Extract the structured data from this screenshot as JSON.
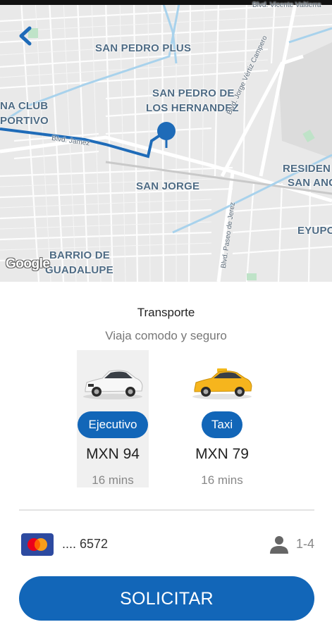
{
  "map": {
    "neighborhoods": [
      "SAN PEDRO PLUS",
      "NA CLUB",
      "PORTIVO",
      "SAN PEDRO DE",
      "LOS HERNANDEZ",
      "SAN JORGE",
      "RESIDEN",
      "SAN ANG",
      "EYUPO",
      "BARRIO DE",
      "GUADALUPE"
    ],
    "streets": [
      "Blvd. Vicente Valtierra",
      "Blvd. Jorge Vértiz Campero",
      "Blvd. Paseo de Jerez",
      "Blvd. Jamez"
    ],
    "attribution": "Google",
    "route_color": "#1e6bb8",
    "pin_color": "#1e6bb8"
  },
  "sheet": {
    "title": "Transporte",
    "subtitle": "Viaja comodo y seguro",
    "options": [
      {
        "label": "Ejecutivo",
        "price": "MXN 94",
        "eta": "16 mins",
        "selected": true,
        "car": "white-sedan"
      },
      {
        "label": "Taxi",
        "price": "MXN 79",
        "eta": "16 mins",
        "selected": false,
        "car": "yellow-taxi"
      }
    ],
    "payment": {
      "card_masked": ".... 6572",
      "brand": "mastercard-icon"
    },
    "passengers": "1-4",
    "cta_label": "SOLICITAR"
  },
  "colors": {
    "accent": "#1266b8"
  }
}
